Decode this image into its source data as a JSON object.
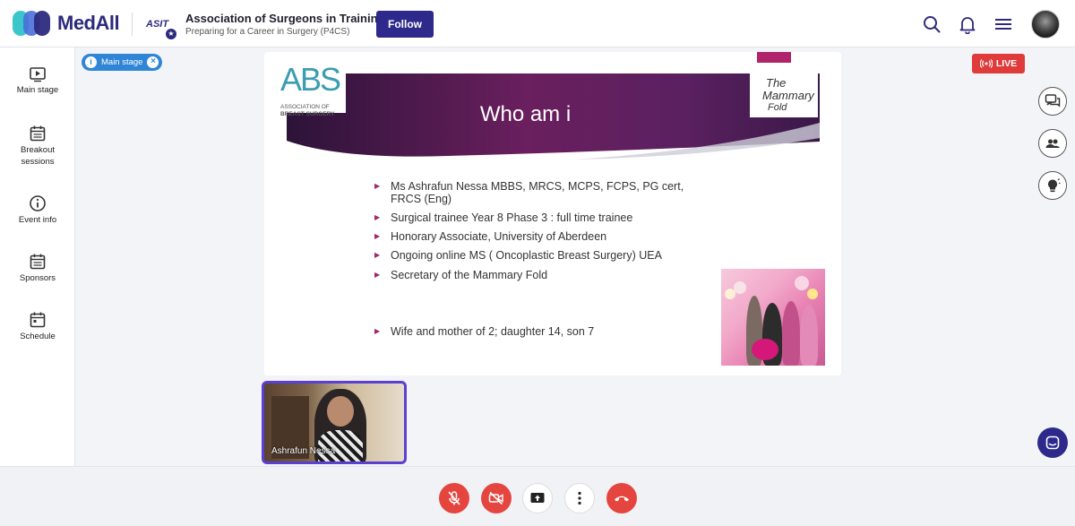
{
  "header": {
    "brand": "MedAll",
    "org_logo_text": "ASIT",
    "org_name": "Association of Surgeons in Training",
    "org_subtitle": "Preparing for a Career in Surgery (P4CS)",
    "follow_label": "Follow",
    "icons": [
      "search-icon",
      "bell-icon",
      "menu-icon",
      "avatar"
    ]
  },
  "sidebar": {
    "items": [
      {
        "label": "Main stage",
        "icon": "play-icon"
      },
      {
        "label": "Breakout sessions",
        "icon": "calendar-icon"
      },
      {
        "label": "Event info",
        "icon": "info-icon"
      },
      {
        "label": "Sponsors",
        "icon": "calendar-icon"
      },
      {
        "label": "Schedule",
        "icon": "calendar-icon"
      }
    ]
  },
  "stage": {
    "chip_label": "Main stage",
    "live_label": "LIVE"
  },
  "slide": {
    "title": "Who am i",
    "abs_logo_big": "ABS",
    "abs_logo_small_1": "ASSOCIATION OF",
    "abs_logo_small_2": "BREAST SURGERY",
    "mf_logo_line1": "The",
    "mf_logo_line2": "Mammary",
    "mf_logo_line3": "Fold",
    "bullets": [
      "Ms  Ashrafun Nessa MBBS, MRCS, MCPS, FCPS, PG cert, FRCS (Eng)",
      "Surgical trainee Year 8 Phase 3 : full time trainee",
      "Honorary Associate, University of Aberdeen",
      "Ongoing online MS ( Oncoplastic Breast Surgery) UEA",
      "Secretary of the Mammary Fold",
      "Wife and mother of 2; daughter 14, son 7"
    ]
  },
  "speaker": {
    "name": "Ashrafun Nessa"
  },
  "colors": {
    "brand": "#2e2a8c",
    "live": "#e03b3b",
    "chip": "#2f86d6",
    "slide_accent": "#a0266c"
  }
}
